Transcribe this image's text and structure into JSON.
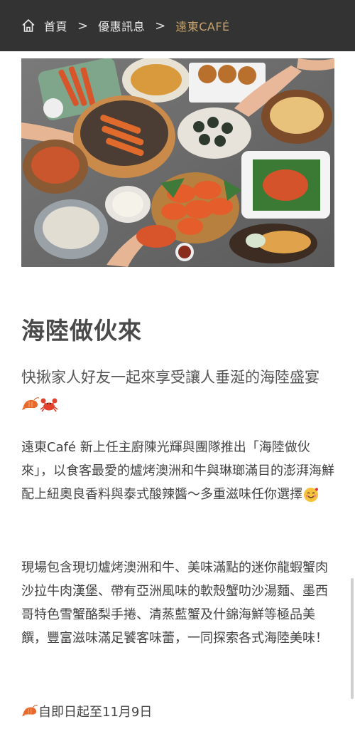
{
  "breadcrumb": {
    "home": "首頁",
    "separator": ">",
    "section": "優惠訊息",
    "current": "遠東CAFÉ"
  },
  "article": {
    "title": "海陸做伙來",
    "subtitle": "快揪家人好友一起來享受讓人垂涎的海陸盛宴",
    "subtitle_icons": [
      "shrimp-icon",
      "crab-icon"
    ],
    "paragraph1": "遠東Café 新上任主廚陳光輝與團隊推出「海陸做伙來」，以食客最愛的爐烤澳洲和牛與琳瑯滿目的澎湃海鮮配上紐奧良香料與泰式酸辣醬～多重滋味任你選擇",
    "paragraph1_icon": "smiling-face-with-hearts-icon",
    "paragraph2": "現場包含現切爐烤澳洲和牛、美味滿點的迷你龍蝦蟹肉沙拉牛肉漢堡、帶有亞洲風味的軟殼蟹叻沙湯麵、墨西哥特色雪蟹酪梨手捲、清蒸藍蟹及什錦海鮮等極品美饌，豐富滋味滿足饕客味蕾，一同探索各式海陸美味！",
    "date_icon": "shrimp-icon",
    "date_text": "自即日起至11月9日"
  },
  "colors": {
    "topbar": "#333333",
    "accent": "#c9a46a",
    "body_text": "#444444"
  }
}
